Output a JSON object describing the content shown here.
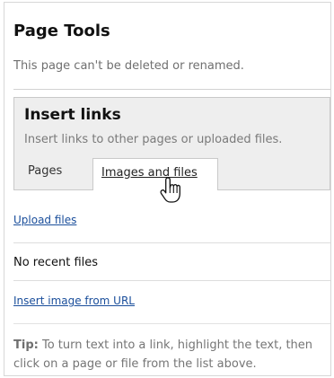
{
  "panel": {
    "title": "Page Tools",
    "subtitle": "This page can't be deleted or renamed."
  },
  "insert_links": {
    "title": "Insert links",
    "description": "Insert links to other pages or uploaded files.",
    "tabs": [
      {
        "label": "Pages"
      },
      {
        "label": "Images and files"
      }
    ]
  },
  "actions": {
    "upload_files": "Upload files",
    "no_recent_files": "No recent files",
    "insert_image_url": "Insert image from URL"
  },
  "tip": {
    "label": "Tip:",
    "text": " To turn text into a link, highlight the text, then click on a page or file from the list above."
  },
  "icons": {
    "cursor": "hand-pointer-icon"
  },
  "colors": {
    "link": "#1a4e9b",
    "box": "#eeeeee"
  }
}
